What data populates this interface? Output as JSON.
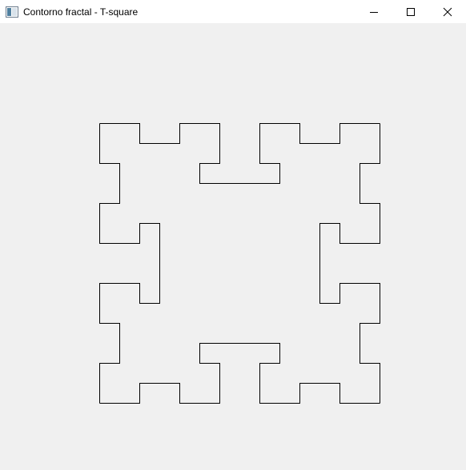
{
  "window": {
    "title": "Contorno fractal - T-square",
    "icon": "app-window-icon",
    "controls": [
      "minimize-icon",
      "maximize-icon",
      "close-icon"
    ]
  },
  "canvas": {
    "background": "#f0f0f0",
    "stroke_color": "#000000",
    "figure": "T-square fractal outline"
  }
}
